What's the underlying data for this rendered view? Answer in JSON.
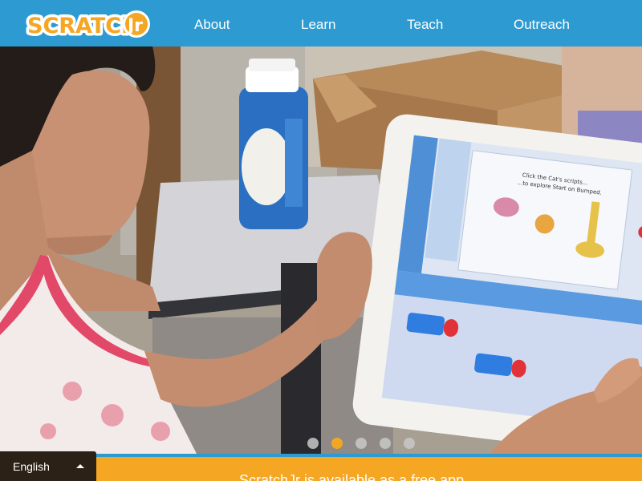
{
  "header": {
    "logo_text": "ScratchJr",
    "nav": [
      {
        "label": "About"
      },
      {
        "label": "Learn"
      },
      {
        "label": "Teach"
      },
      {
        "label": "Outreach"
      }
    ]
  },
  "hero": {
    "image_description_icon": "photo-child-using-tablet",
    "tablet_caption_line1": "Click the Cat's scripts...",
    "tablet_caption_line2": "...to explore Start on Bumped.",
    "carousel": {
      "total_slides": 5,
      "active_index": 1
    }
  },
  "band": {
    "text": "ScratchJr is available as a free app"
  },
  "language": {
    "selected": "English",
    "icon": "caret-up-icon"
  },
  "colors": {
    "header_bg": "#2d9bd2",
    "band_bg": "#f5a623",
    "dot_active": "#f2a625",
    "lang_bg": "#2b2116"
  }
}
